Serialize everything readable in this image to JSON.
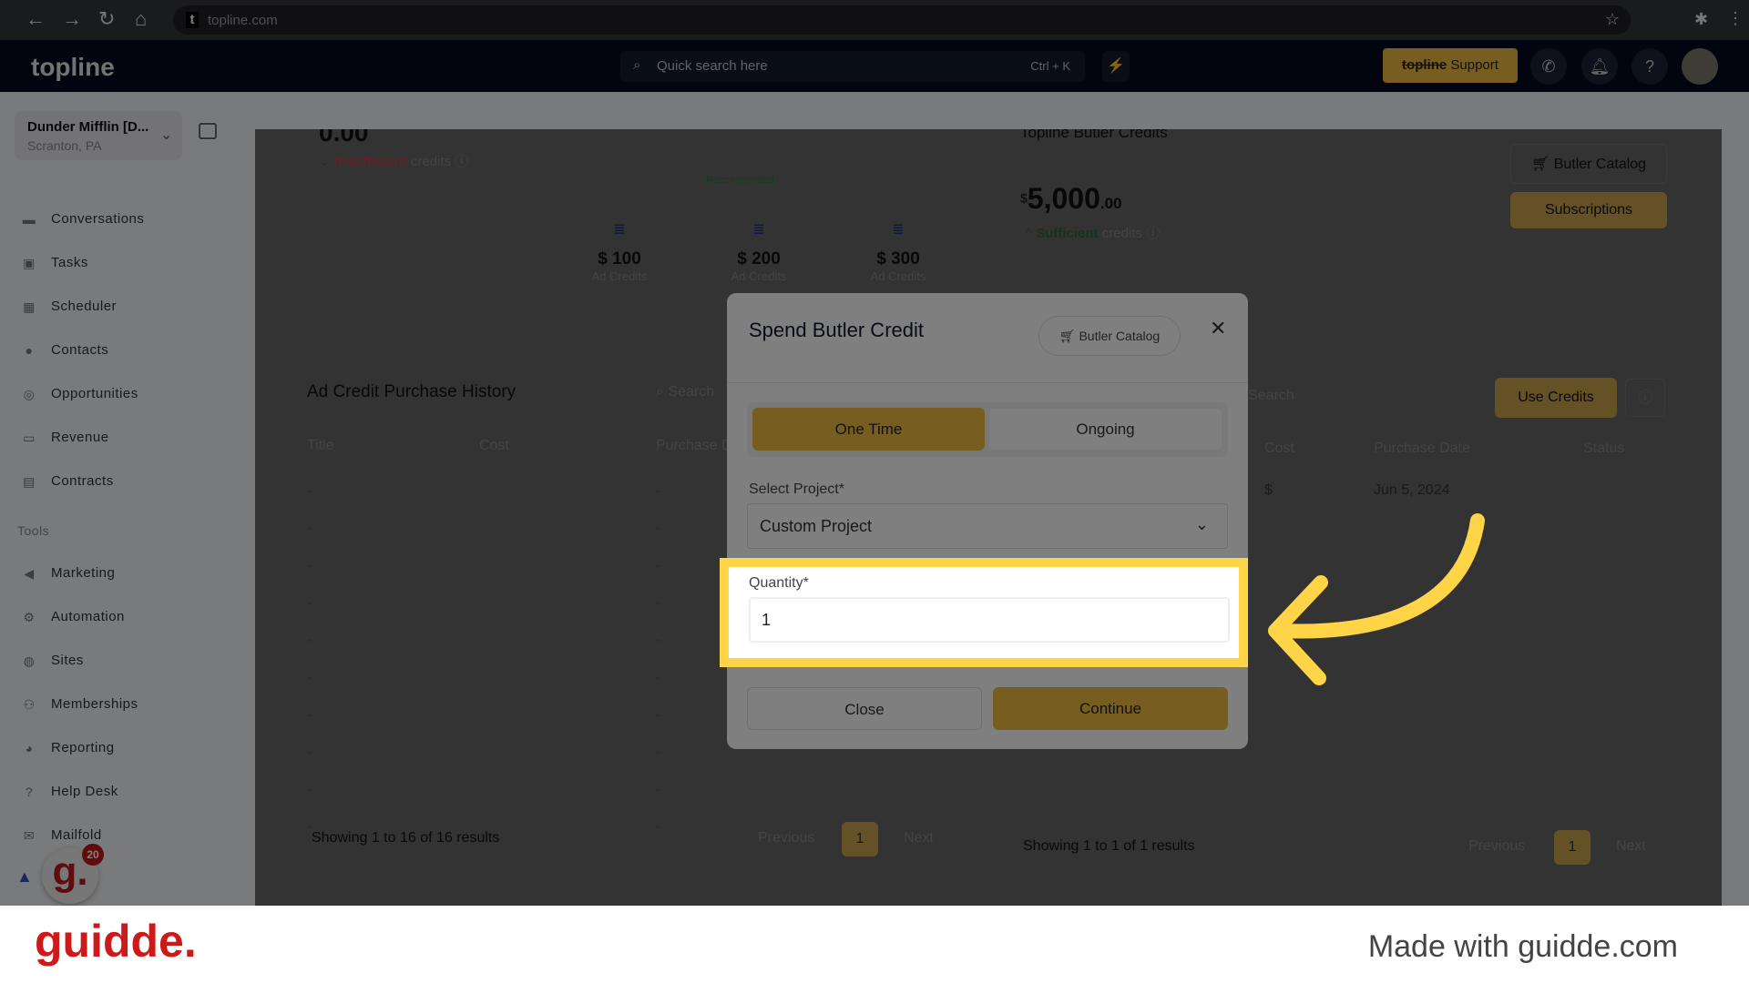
{
  "browser": {
    "url": "topline.com"
  },
  "header": {
    "logo": "topline",
    "search_placeholder": "Quick search here",
    "search_shortcut": "Ctrl + K",
    "support_brand": "topline",
    "support_label": "Support"
  },
  "sidebar": {
    "account_name": "Dunder Mifflin [D...",
    "account_location": "Scranton, PA",
    "items": [
      {
        "label": "Conversations"
      },
      {
        "label": "Tasks"
      },
      {
        "label": "Scheduler"
      },
      {
        "label": "Contacts"
      },
      {
        "label": "Opportunities"
      },
      {
        "label": "Revenue"
      },
      {
        "label": "Contracts"
      }
    ],
    "tools_heading": "Tools",
    "tools": [
      {
        "label": "Marketing"
      },
      {
        "label": "Automation"
      },
      {
        "label": "Sites"
      },
      {
        "label": "Memberships"
      },
      {
        "label": "Reporting"
      },
      {
        "label": "Help Desk"
      },
      {
        "label": "Mailfold"
      }
    ],
    "badge_count": "20"
  },
  "ad_credits": {
    "balance": "0.00",
    "status_word": "Insufficient",
    "status_suffix": "credits",
    "recommended": "Recommended",
    "packages": [
      {
        "amount": "$ 100",
        "label": "Ad Credits"
      },
      {
        "amount": "$ 200",
        "label": "Ad Credits"
      },
      {
        "amount": "$ 300",
        "label": "Ad Credits"
      }
    ],
    "history_title": "Ad Credit Purchase History",
    "search_placeholder": "Search",
    "columns": [
      "Title",
      "Cost",
      "Purchase Date"
    ],
    "row_placeholder": "-",
    "summary": "Showing 1 to 16 of 16 results",
    "prev": "Previous",
    "page": "1",
    "next": "Next"
  },
  "butler": {
    "title": "Topline Butler Credits",
    "currency": "$",
    "amount": "5,000",
    "cents": ".00",
    "status_word": "Sufficient",
    "status_suffix": "credits",
    "catalog_label": "Butler Catalog",
    "subscriptions_label": "Subscriptions",
    "search_placeholder": "Search",
    "use_credits_label": "Use Credits",
    "columns": [
      "Cost",
      "Purchase Date",
      "Status"
    ],
    "rows": [
      {
        "cost": "$",
        "date": "Jun 5, 2024",
        "status": ""
      }
    ],
    "summary": "Showing 1 to 1 of 1 results",
    "prev": "Previous",
    "page": "1",
    "next": "Next"
  },
  "modal": {
    "title": "Spend Butler Credit",
    "catalog_label": "Butler Catalog",
    "tabs": [
      {
        "label": "One Time",
        "active": true
      },
      {
        "label": "Ongoing",
        "active": false
      }
    ],
    "project_label": "Select Project*",
    "project_value": "Custom Project",
    "quantity_label": "Quantity*",
    "quantity_value": "1",
    "close_label": "Close",
    "continue_label": "Continue"
  },
  "colors": {
    "accent": "#f0bb40",
    "highlight": "#ffd447",
    "nav": "#040a1f",
    "guidde_red": "#cc1a1a"
  },
  "guidde": {
    "logo": "guidde.",
    "footer": "Made with guidde.com"
  }
}
